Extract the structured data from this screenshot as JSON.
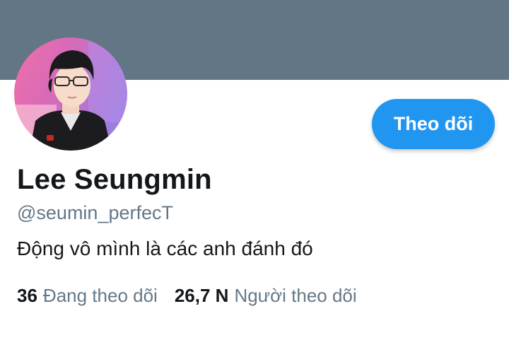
{
  "profile": {
    "display_name": "Lee Seungmin",
    "handle": "@seumin_perfecT",
    "bio": "Động vô mình là các anh đánh đó",
    "follow_button_label": "Theo dõi"
  },
  "stats": {
    "following_count": "36",
    "following_label": "Đang theo dõi",
    "followers_count": "26,7 N",
    "followers_label": "Người theo dõi"
  },
  "colors": {
    "banner": "#637686",
    "accent": "#2196f0",
    "text_primary": "#14171a",
    "text_secondary": "#657786"
  }
}
